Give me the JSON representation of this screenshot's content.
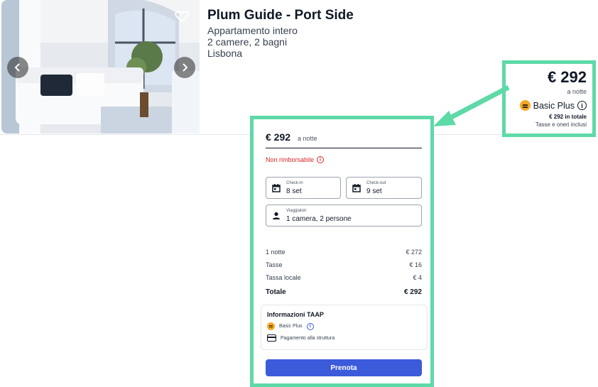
{
  "listing": {
    "title": "Plum Guide - Port Side",
    "type": "Appartamento intero",
    "rooms": "2 camere, 2 bagni",
    "city": "Lisbona"
  },
  "price_box": {
    "price": "€ 292",
    "per_night": "a notte",
    "plan": "Basic Plus",
    "total": "€ 292 in totale",
    "taxes_note": "Tasse e oneri inclusi"
  },
  "booking": {
    "price": "€ 292",
    "per_night": "a notte",
    "refund_policy": "Non rimborsabile",
    "checkin": {
      "label": "Check-in",
      "value": "8 set"
    },
    "checkout": {
      "label": "Check-out",
      "value": "9 set"
    },
    "guests": {
      "label": "Viaggiatori",
      "value": "1 camera, 2 persone"
    },
    "breakdown": [
      {
        "label": "1 notte",
        "amount": "€ 272"
      },
      {
        "label": "Tasse",
        "amount": "€ 16"
      },
      {
        "label": "Tassa locale",
        "amount": "€ 4"
      }
    ],
    "total": {
      "label": "Totale",
      "amount": "€ 292"
    },
    "taap": {
      "title": "Informazioni TAAP",
      "plan": "Basic Plus",
      "payment": "Pagamento alla struttura"
    },
    "book_label": "Prenota"
  },
  "colors": {
    "highlight": "#5ed9a8",
    "primary": "#3b5bdb",
    "warning": "#dc2626",
    "plan_badge": "#f5a623"
  },
  "icons": [
    "heart-icon",
    "chevron-left-icon",
    "chevron-right-icon",
    "info-icon",
    "calendar-icon",
    "person-icon",
    "credit-card-icon",
    "plan-badge-icon"
  ]
}
